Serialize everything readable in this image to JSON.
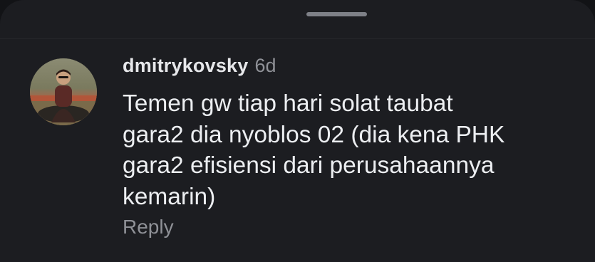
{
  "comment": {
    "username": "dmitrykovsky",
    "timestamp": "6d",
    "text": "Temen gw tiap hari solat taubat\ngara2 dia nyoblos 02 (dia kena PHK\ngara2 efisiensi dari perusahaannya\nkemarin)",
    "reply_label": "Reply",
    "avatar_icon": "user-avatar-photo"
  },
  "colors": {
    "background": "#1c1d21",
    "username": "#e6e7ea",
    "meta_text": "#8f9197",
    "body_text": "#eceef1",
    "handle": "#7e8087"
  }
}
